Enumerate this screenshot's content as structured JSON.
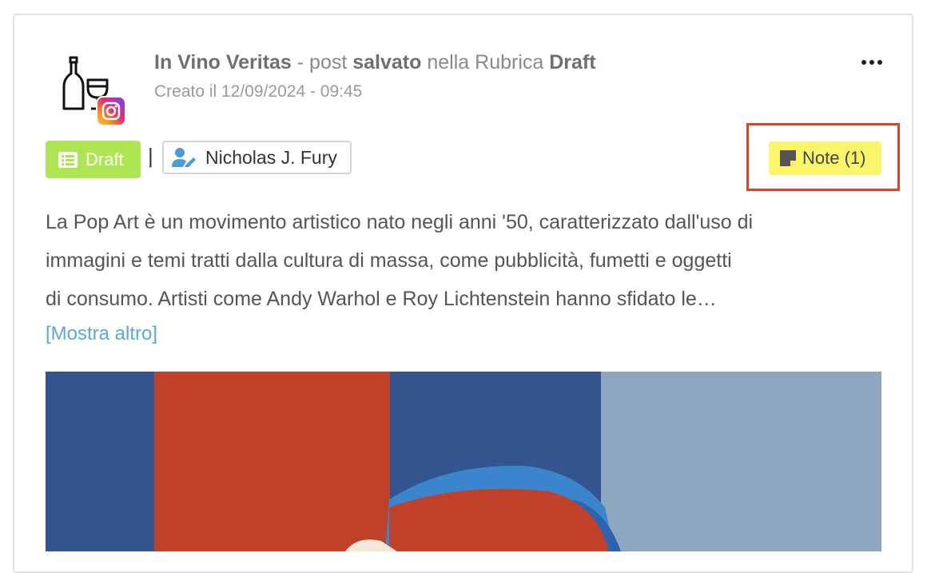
{
  "post": {
    "account_name": "In Vino Veritas",
    "sep_dash": " - post ",
    "status_word": "salvato",
    "in_rubrica": " nella Rubrica ",
    "rubrica_name": "Draft",
    "created": "Creato il 12/09/2024 - 09:45",
    "avatar_icon": "wine-bottle-glass-icon",
    "platform_icon": "instagram-icon"
  },
  "badges": {
    "draft_label": "Draft",
    "draft_color": "#aee553",
    "separator": "|",
    "user_label": "Nicholas J. Fury",
    "note_label": "Note (1)",
    "note_color": "#fbf56a",
    "highlight_color": "#d9442c"
  },
  "content": {
    "lines": [
      "La Pop Art è un movimento artistico nato negli anni '50, caratterizzato dall'uso di",
      "immagini e temi tratti dalla cultura di massa, come pubblicità, fumetti e oggetti",
      "di consumo. Artisti come Andy Warhol e Roy Lichtenstein hanno sfidato le…"
    ],
    "show_more": "[Mostra altro]"
  },
  "image": {
    "colors": {
      "navy": "#33548f",
      "red": "#c0402a",
      "light_blue": "#8fa6c1",
      "sky": "#3a85cc",
      "cream": "#f5e6da"
    }
  }
}
